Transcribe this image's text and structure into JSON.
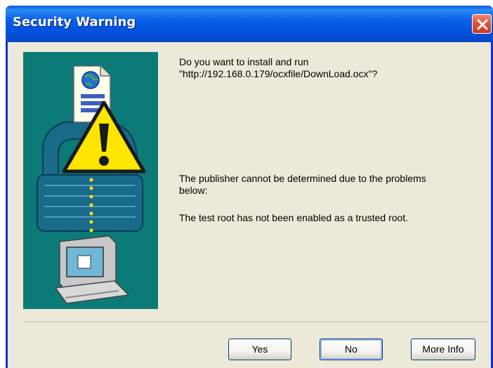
{
  "window": {
    "title": "Security Warning"
  },
  "message": {
    "question_line1": "Do you want to install and run",
    "question_line2": "\"http://192.168.0.179/ocxfile/DownLoad.ocx\"?",
    "publisher_line1": "The publisher cannot be determined due to the problems",
    "publisher_line2": "below:",
    "reason": "The test root has not been enabled as a trusted root."
  },
  "buttons": {
    "yes_label": "Yes",
    "no_label": "No",
    "more_info_label": "More Info"
  },
  "colors": {
    "titlebar": "#0351dd",
    "client_bg": "#ece9d8",
    "art_panel": "#0c7a76",
    "close_button": "#e0553a"
  },
  "icons": [
    "close-icon",
    "warning-icon",
    "document-globe-icon",
    "padlock-icon",
    "computer-icon"
  ]
}
